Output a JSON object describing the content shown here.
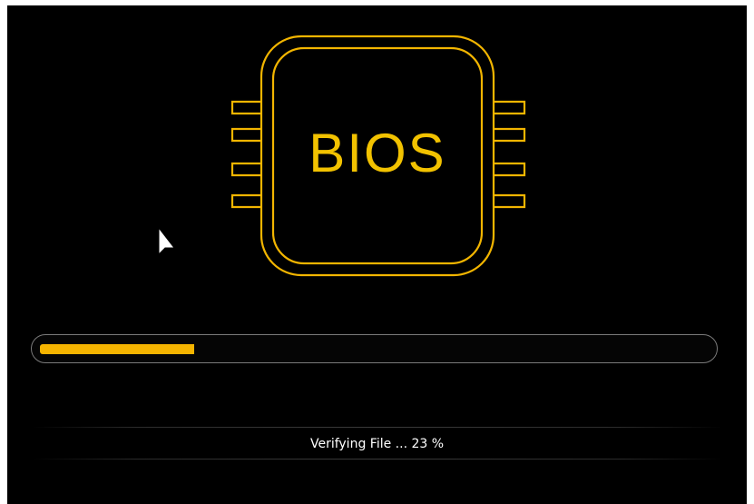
{
  "logo": {
    "label": "BIOS",
    "icon": "bios-chip-icon",
    "color": "#f2c200"
  },
  "cursor": {
    "icon": "mouse-pointer-icon"
  },
  "progress": {
    "percent": 23,
    "fill_color": "#f5b400",
    "track_border_color": "#7a7a7a"
  },
  "status": {
    "text": "Verifying File ... 23 %"
  },
  "colors": {
    "background": "#000000",
    "text": "#ffffff"
  }
}
